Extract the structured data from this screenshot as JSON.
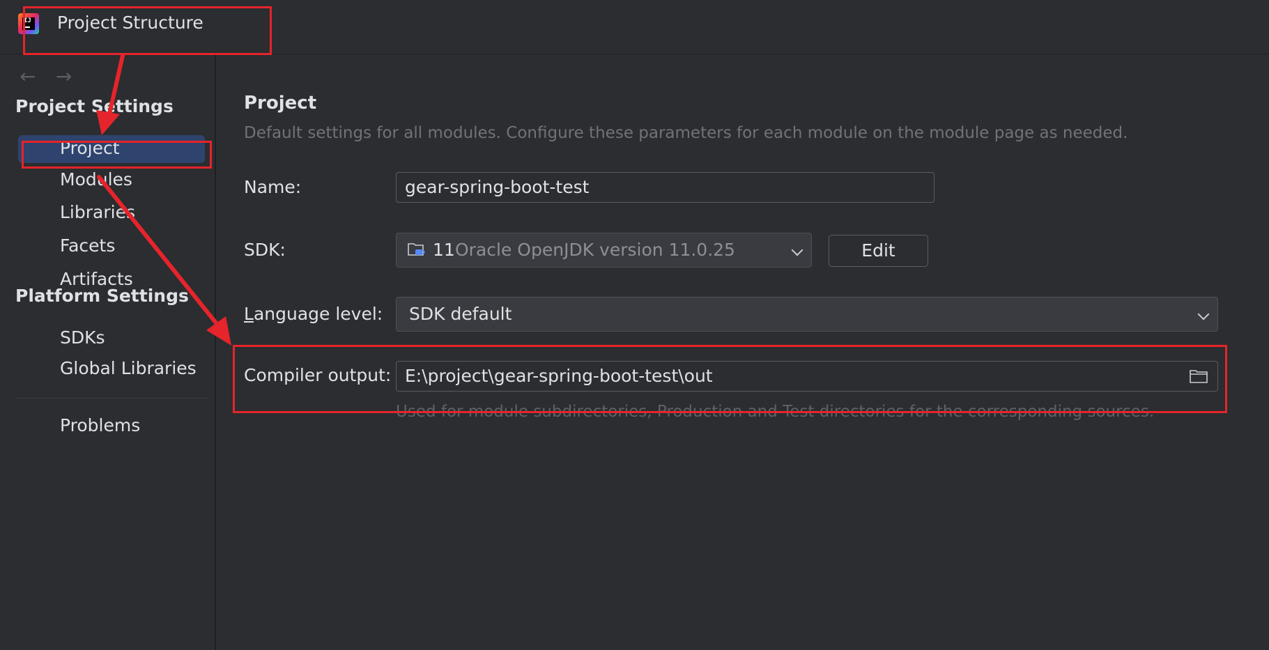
{
  "window": {
    "title": "Project Structure"
  },
  "nav": {
    "back_icon": "arrow-left-icon",
    "forward_icon": "arrow-right-icon"
  },
  "sidebar": {
    "project_settings_title": "Project Settings",
    "project_items": [
      {
        "label": "Project",
        "selected": true
      },
      {
        "label": "Modules"
      },
      {
        "label": "Libraries"
      },
      {
        "label": "Facets"
      },
      {
        "label": "Artifacts"
      }
    ],
    "platform_settings_title": "Platform Settings",
    "platform_items": [
      {
        "label": "SDKs"
      },
      {
        "label": "Global Libraries"
      }
    ],
    "problems_label": "Problems"
  },
  "main": {
    "title": "Project",
    "description": "Default settings for all modules. Configure these parameters for each module on the module page as needed.",
    "name": {
      "label": "Name:",
      "value": "gear-spring-boot-test"
    },
    "sdk": {
      "label": "SDK:",
      "version": "11",
      "description": "Oracle OpenJDK version 11.0.25",
      "icon": "jdk-folder-icon",
      "edit_label": "Edit"
    },
    "language_level": {
      "label_prefix": "L",
      "label_rest": "anguage level:",
      "value": "SDK default"
    },
    "compiler_output": {
      "label": "Compiler output:",
      "value": "E:\\project\\gear-spring-boot-test\\out",
      "hint": "Used for module subdirectories, Production and Test directories for the corresponding sources."
    }
  },
  "annotation": {
    "color": "#e5242b"
  },
  "colors": {
    "background": "#2b2d30",
    "selected_item": "#2e436e",
    "text": "#dfe1e5",
    "muted_text": "#6f737a"
  }
}
